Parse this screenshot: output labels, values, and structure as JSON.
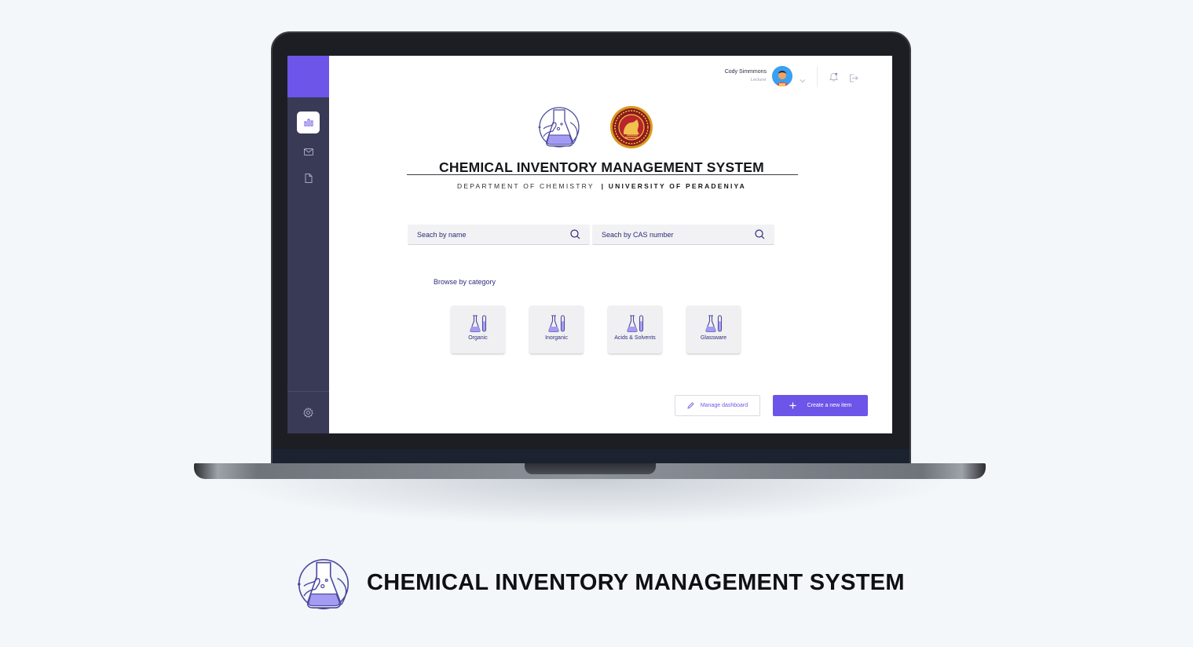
{
  "user": {
    "name": "Cody Simmmons",
    "role": "Lecturer"
  },
  "header": {
    "title": "CHEMICAL INVENTORY MANAGEMENT SYSTEM",
    "department": "DEPARTMENT OF CHEMISTRY",
    "university": "| UNIVERSITY OF PERADENIYA"
  },
  "search": {
    "name_placeholder": "Seach by name",
    "cas_placeholder": "Seach by CAS number"
  },
  "browse": {
    "label": "Browse by category",
    "categories": [
      {
        "label": "Organic"
      },
      {
        "label": "Inorganic"
      },
      {
        "label": "Acids & Solvents"
      },
      {
        "label": "Glassware"
      }
    ]
  },
  "actions": {
    "manage_label": "Manage dashboard",
    "create_label": "Create a new item"
  },
  "footer": {
    "title": "CHEMICAL INVENTORY MANAGEMENT SYSTEM"
  },
  "icons": {
    "sidebar": [
      "bar-chart-icon",
      "mail-icon",
      "document-icon",
      "settings-icon"
    ],
    "topbar": [
      "chevron-down-icon",
      "bell-icon",
      "logout-icon"
    ]
  },
  "colors": {
    "accent": "#6c55e8",
    "sidebar": "#383a56",
    "text_accent": "#2d2b7e"
  }
}
